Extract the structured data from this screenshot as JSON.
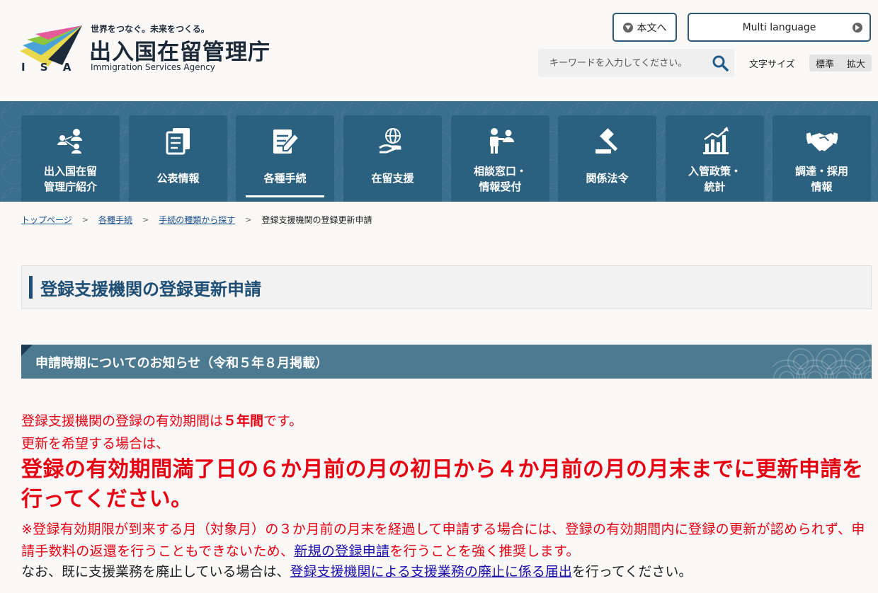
{
  "header": {
    "logo_abbr": "I S A",
    "tagline": "世界をつなぐ。未来をつくる。",
    "agency_name_ja": "出入国在留管理庁",
    "agency_name_en": "Immigration Services Agency",
    "skip_to_content": "本文へ",
    "multi_language": "Multi language",
    "search_placeholder": "キーワードを入力してください。",
    "font_size_label": "文字サイズ",
    "font_size_options": [
      "標準",
      "拡大"
    ]
  },
  "nav": {
    "items": [
      {
        "label": "出入国在留\n管理庁紹介",
        "icon": "people-network-icon"
      },
      {
        "label": "公表情報",
        "icon": "documents-icon"
      },
      {
        "label": "各種手続",
        "icon": "form-pen-icon",
        "active": true
      },
      {
        "label": "在留支援",
        "icon": "globe-hand-icon"
      },
      {
        "label": "相談窓口・\n情報受付",
        "icon": "consultation-icon"
      },
      {
        "label": "関係法令",
        "icon": "gavel-icon"
      },
      {
        "label": "入管政策・\n統計",
        "icon": "bar-chart-icon"
      },
      {
        "label": "調達・採用\n情報",
        "icon": "handshake-icon"
      }
    ]
  },
  "breadcrumb": {
    "items": [
      "トップページ",
      "各種手続",
      "手続の種類から探す"
    ],
    "current": "登録支援機関の登録更新申請"
  },
  "main": {
    "title": "登録支援機関の登録更新申請",
    "section_heading": "申請時期についてのお知らせ（令和５年８月掲載）",
    "line1_pre": "登録支援機関の登録の有効期間は",
    "line1_bold": "５年間",
    "line1_post": "です。",
    "line2": "更新を希望する場合は、",
    "big_notice": "登録の有効期間満了日の６か月前の月の初日から４か月前の月の月末までに更新申請を行ってください。",
    "note_pre": "※登録有効期限が到来する月（対象月）の３か月前の月末を経過して申請する場合には、登録の有効期間内に登録の更新が認められず、申請手数料の返還を行うこともできないため、",
    "note_link": "新規の登録申請",
    "note_post": "を行うことを強く推奨します。",
    "last_pre": "なお、既に支援業務を廃止している場合は、",
    "last_link": "登録支援機関による支援業務の廃止に係る届出",
    "last_post": "を行ってください。"
  },
  "colors": {
    "nav_bg": "#3a6f8f",
    "nav_item": "#2b607f",
    "title_accent": "#1f4f75",
    "section_bg": "#4c7a91",
    "alert_red": "#e60012",
    "link_blue": "#1a0dab"
  }
}
